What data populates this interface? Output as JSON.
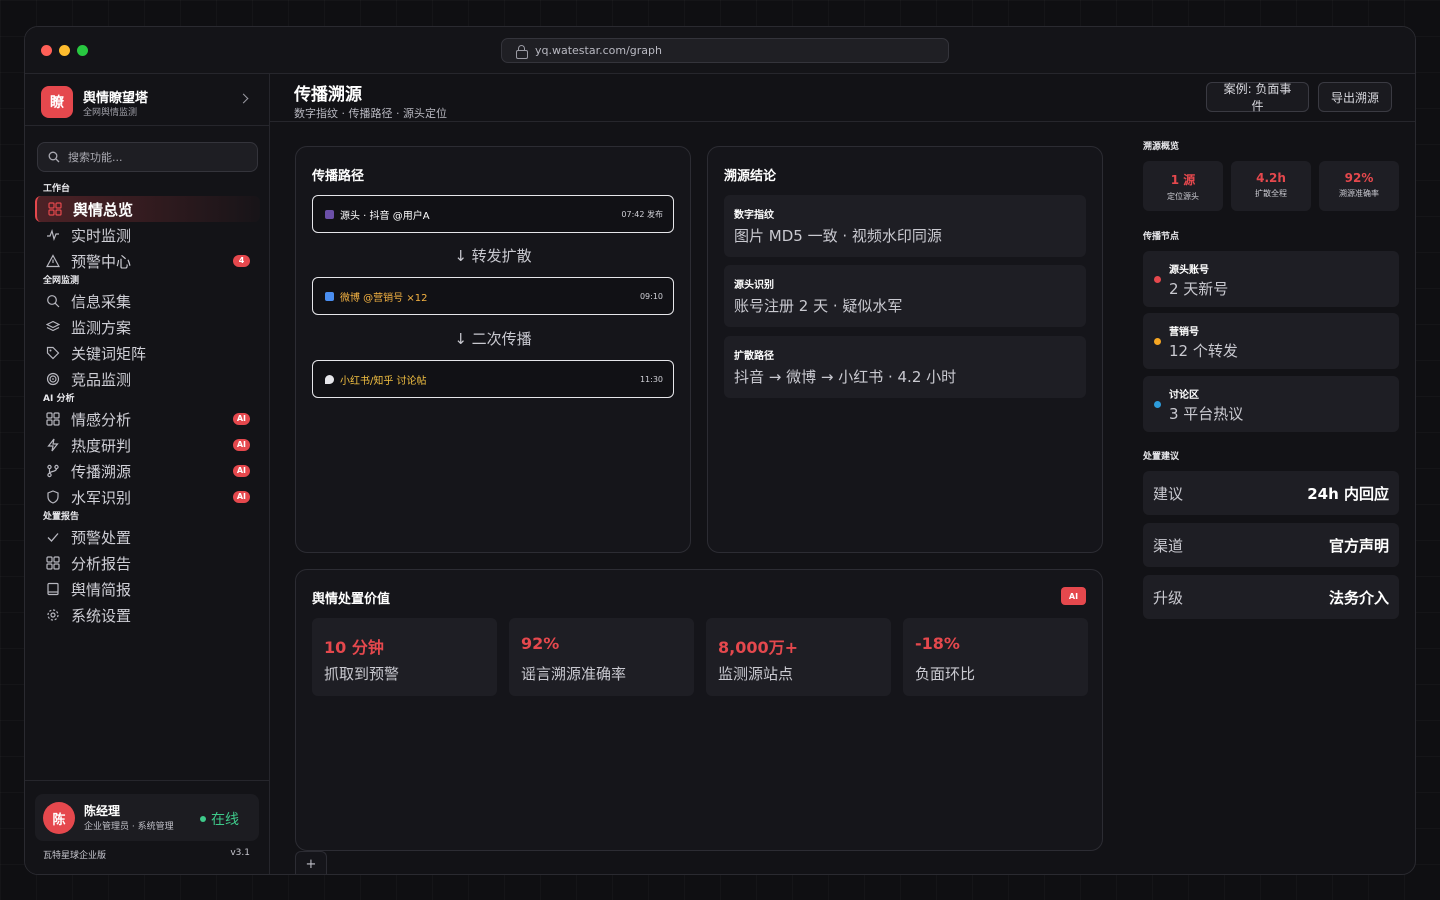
{
  "browser": {
    "url": "yq.watestar.com/graph"
  },
  "colors": {
    "accent": "#e5484d",
    "online": "#3ec98a",
    "dot_red": "#ff5f57",
    "dot_yellow": "#febc2e",
    "dot_green": "#28c840"
  },
  "brand": {
    "logo_char": "瞭",
    "name": "舆情瞭望塔",
    "subtitle": "全网舆情监测"
  },
  "search": {
    "placeholder": "搜索功能..."
  },
  "sidebar": {
    "groups": [
      {
        "label": "工作台",
        "items": [
          {
            "label": "舆情总览",
            "icon": "grid-icon",
            "active": true
          },
          {
            "label": "实时监测",
            "icon": "pulse-icon"
          },
          {
            "label": "预警中心",
            "icon": "warning-icon",
            "badge": "4"
          }
        ]
      },
      {
        "label": "全网监测",
        "items": [
          {
            "label": "信息采集",
            "icon": "search-icon"
          },
          {
            "label": "监测方案",
            "icon": "layers-icon"
          },
          {
            "label": "关键词矩阵",
            "icon": "tag-icon"
          },
          {
            "label": "竞品监测",
            "icon": "target-icon"
          }
        ]
      },
      {
        "label": "AI 分析",
        "items": [
          {
            "label": "情感分析",
            "icon": "grid-icon",
            "badge": "AI"
          },
          {
            "label": "热度研判",
            "icon": "bolt-icon",
            "badge": "AI"
          },
          {
            "label": "传播溯源",
            "icon": "branch-icon",
            "badge": "AI"
          },
          {
            "label": "水军识别",
            "icon": "shield-icon",
            "badge": "AI"
          }
        ]
      },
      {
        "label": "处置报告",
        "items": [
          {
            "label": "预警处置",
            "icon": "check-icon"
          },
          {
            "label": "分析报告",
            "icon": "grid-icon"
          },
          {
            "label": "舆情简报",
            "icon": "book-icon"
          },
          {
            "label": "系统设置",
            "icon": "gear-icon"
          }
        ]
      }
    ]
  },
  "user": {
    "avatar_char": "陈",
    "name": "陈经理",
    "role": "企业管理员 · 系统管理",
    "status": "在线"
  },
  "footer": {
    "edition": "瓦特星球企业版",
    "version": "v3.1"
  },
  "header": {
    "title": "传播溯源",
    "subtitle": "数字指纹 · 传播路径 · 源头定位",
    "btn_case": "案例: 负面事件",
    "btn_export": "导出溯源"
  },
  "path_card": {
    "title": "传播路径",
    "nodes": [
      {
        "icon": "phone-icon",
        "icon_color": "#6b4fa8",
        "text": "源头 · 抖音 @用户A",
        "text_color": "#ffffff",
        "time": "07:42 发布"
      },
      {
        "icon": "weibo-icon",
        "icon_color": "#4a8ef0",
        "text": "微博 @营销号 ×12",
        "text_color": "#f5b342",
        "time": "09:10"
      },
      {
        "icon": "chat-icon",
        "icon_color": "#e6e6ea",
        "text": "小红书/知乎 讨论帖",
        "text_color": "#f5c242",
        "time": "11:30"
      }
    ],
    "arrows": [
      "↓ 转发扩散",
      "↓ 二次传播"
    ]
  },
  "conclusion_card": {
    "title": "溯源结论",
    "items": [
      {
        "key": "数字指纹",
        "value": "图片 MD5 一致 · 视频水印同源"
      },
      {
        "key": "源头识别",
        "value": "账号注册 2 天 · 疑似水军"
      },
      {
        "key": "扩散路径",
        "value": "抖音 → 微博 → 小红书 · 4.2 小时"
      }
    ]
  },
  "value_card": {
    "title": "舆情处置价值",
    "tag": "AI",
    "metrics": [
      {
        "value": "10 分钟",
        "label": "抓取到预警"
      },
      {
        "value": "92%",
        "label": "谣言溯源准确率"
      },
      {
        "value": "8,000万+",
        "label": "监测源站点"
      },
      {
        "value": "-18%",
        "label": "负面环比"
      }
    ]
  },
  "tab_add": "+",
  "right_panel": {
    "overview_title": "溯源概览",
    "stats": [
      {
        "value": "1 源",
        "label": "定位源头"
      },
      {
        "value": "4.2h",
        "label": "扩散全程"
      },
      {
        "value": "92%",
        "label": "溯源准确率"
      }
    ],
    "nodes_title": "传播节点",
    "nodes": [
      {
        "key": "源头账号",
        "value": "2 天新号",
        "color": "#e5484d"
      },
      {
        "key": "营销号",
        "value": "12 个转发",
        "color": "#f5a623"
      },
      {
        "key": "讨论区",
        "value": "3 平台热议",
        "color": "#2d9cdb"
      }
    ],
    "suggest_title": "处置建议",
    "suggestions": [
      {
        "key": "建议",
        "value": "24h 内回应"
      },
      {
        "key": "渠道",
        "value": "官方声明"
      },
      {
        "key": "升级",
        "value": "法务介入"
      }
    ]
  }
}
